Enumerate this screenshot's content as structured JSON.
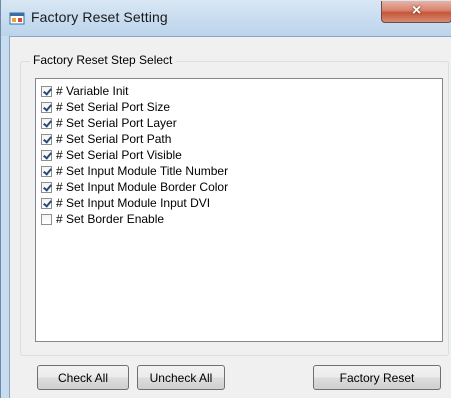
{
  "window": {
    "title": "Factory Reset Setting",
    "close_glyph": "×",
    "icon": "app-window-icon"
  },
  "group": {
    "label": "Factory Reset Step Select"
  },
  "steps": [
    {
      "label": "# Variable Init",
      "checked": true
    },
    {
      "label": "# Set Serial Port Size",
      "checked": true
    },
    {
      "label": "# Set Serial Port Layer",
      "checked": true
    },
    {
      "label": "# Set Serial Port Path",
      "checked": true
    },
    {
      "label": "# Set Serial Port Visible",
      "checked": true
    },
    {
      "label": "# Set Input Module Title Number",
      "checked": true
    },
    {
      "label": "# Set Input Module Border Color",
      "checked": true
    },
    {
      "label": "# Set Input Module Input DVI",
      "checked": true
    },
    {
      "label": "# Set Border Enable",
      "checked": false
    }
  ],
  "buttons": {
    "check_all": "Check All",
    "uncheck_all": "Uncheck All",
    "factory_reset": "Factory Reset"
  },
  "colors": {
    "frame": "#c7dcef",
    "client": "#f0f0f0",
    "close_button": "#c4563b"
  }
}
